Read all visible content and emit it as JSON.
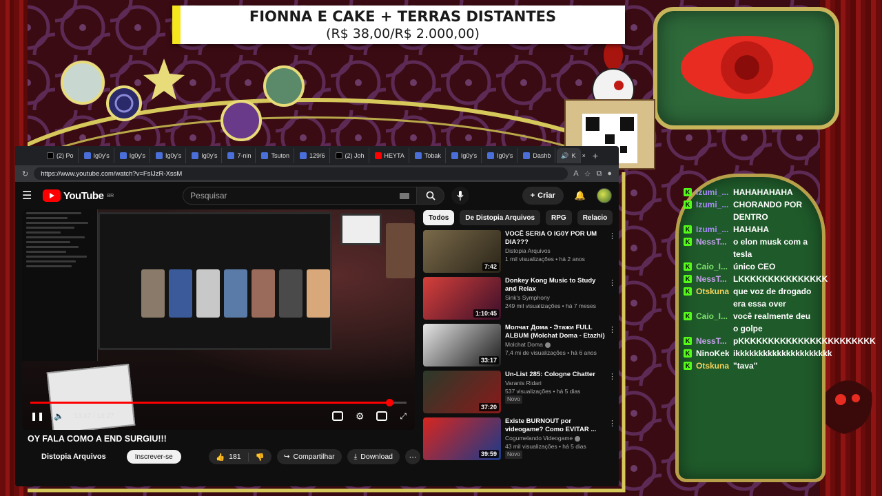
{
  "overlay": {
    "goal_title": "FIONNA E CAKE + TERRAS DISTANTES",
    "goal_progress": "(R$ 38,00/R$ 2.000,00)",
    "goal_progress_fraction": 0.019,
    "colors": {
      "banner_accent": "#f4e51e",
      "chat_bg": "#1f5a2a",
      "frame_gold": "#c8b45a",
      "curtain": "#8e1414"
    }
  },
  "browser": {
    "tabs": [
      {
        "label": "(2) Po",
        "icon": "x-icon"
      },
      {
        "label": "Ig0y's",
        "icon": "page-icon"
      },
      {
        "label": "Ig0y's",
        "icon": "page-icon"
      },
      {
        "label": "Ig0y's",
        "icon": "page-icon"
      },
      {
        "label": "Ig0y's",
        "icon": "page-icon"
      },
      {
        "label": "7-nin",
        "icon": "page-icon"
      },
      {
        "label": "Tsuton",
        "icon": "page-icon"
      },
      {
        "label": "129/6",
        "icon": "page-icon"
      },
      {
        "label": "(2) Joh",
        "icon": "x-icon"
      },
      {
        "label": "HEYTA",
        "icon": "youtube-icon"
      },
      {
        "label": "Tobak",
        "icon": "page-icon"
      },
      {
        "label": "Ig0y's",
        "icon": "page-icon"
      },
      {
        "label": "Ig0y's",
        "icon": "page-icon"
      },
      {
        "label": "Dashb",
        "icon": "page-icon"
      }
    ],
    "active_tab_label": "K",
    "url": "https://www.youtube.com/watch?v=FsIJzR-XssM"
  },
  "youtube": {
    "logo_text": "YouTube",
    "logo_region": "BR",
    "search_placeholder": "Pesquisar",
    "create_label": "Criar",
    "video": {
      "time_current": "13:47",
      "time_total": "14:27",
      "progress_fraction": 0.954,
      "title": "OY FALA COMO A END SURGIU!!!",
      "channel": "Distopia Arquivos",
      "subscribe_label": "Inscrever-se",
      "likes": "181",
      "share_label": "Compartilhar",
      "download_label": "Download"
    },
    "chips": [
      {
        "label": "Todos",
        "active": true
      },
      {
        "label": "De Distopia Arquivos",
        "active": false
      },
      {
        "label": "RPG",
        "active": false
      },
      {
        "label": "Relacio",
        "active": false
      }
    ],
    "recommendations": [
      {
        "title": "VOCÊ SERIA O IG0Y POR UM DIA???",
        "channel": "Distopia Arquivos",
        "meta": "1 mil visualizações • há 2 anos",
        "duration": "7:42",
        "new": "",
        "colors": [
          "#7a6a4a",
          "#2a2418"
        ]
      },
      {
        "title": "Donkey Kong Music to Study and Relax",
        "channel": "Sink's Symphony",
        "meta": "249 mil visualizações • há 7 meses",
        "duration": "1:10:45",
        "new": "",
        "colors": [
          "#d6403a",
          "#3a0f2a"
        ]
      },
      {
        "title": "Молчат Дома - Этажи FULL ALBUM (Molchat Doma - Etazhi)",
        "channel": "Molchat Doma",
        "meta": "7,4 mi de visualizações • há 6 anos",
        "duration": "33:17",
        "new": "",
        "colors": [
          "#e6e6e6",
          "#1a1a1a"
        ]
      },
      {
        "title": "Un-List 285: Cologne Chatter",
        "channel": "Varanis Ridari",
        "meta": "537 visualizações • há 5 dias",
        "duration": "37:20",
        "new": "Novo",
        "colors": [
          "#2a3a2a",
          "#8a1a1a"
        ]
      },
      {
        "title": "Existe BURNOUT por videogame? Como EVITAR ...",
        "channel": "Cogumelando Videogame",
        "meta": "43 mil visualizações • há 5 dias",
        "duration": "39:59",
        "new": "Novo",
        "colors": [
          "#d8261e",
          "#1a3a8a"
        ]
      }
    ]
  },
  "chat": [
    {
      "user": "Izumi_...",
      "text": "HAHAHAHAHA",
      "color": "#a78bfa"
    },
    {
      "user": "Izumi_...",
      "text": "CHORANDO POR DENTRO",
      "color": "#a78bfa"
    },
    {
      "user": "Izumi_...",
      "text": "HAHAHA",
      "color": "#a78bfa"
    },
    {
      "user": "NessT...",
      "text": "o elon musk com a tesla",
      "color": "#c8a2f0"
    },
    {
      "user": "Caio_I...",
      "text": "único CEO",
      "color": "#7fe36b"
    },
    {
      "user": "NessT...",
      "text": "LKKKKKKKKKKKKKKK",
      "color": "#c8a2f0"
    },
    {
      "user": "Otskuna",
      "text": "que voz de drogado era essa over",
      "color": "#f4d35e"
    },
    {
      "user": "Caio_I...",
      "text": "você realmente deu o golpe",
      "color": "#7fe36b"
    },
    {
      "user": "NessT...",
      "text": "pKKKKKKKKKKKKKKKKKKKKKKK",
      "color": "#c8a2f0"
    },
    {
      "user": "NinoKek",
      "text": "ikkkkkkkkkkkkkkkkkkkkk",
      "color": "#ffffff"
    },
    {
      "user": "Otskuna",
      "text": "\"tava\"",
      "color": "#f4d35e"
    }
  ]
}
